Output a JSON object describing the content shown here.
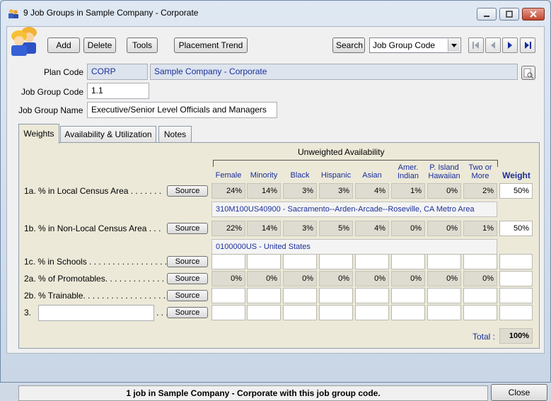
{
  "window": {
    "title": "9 Job Groups in Sample Company - Corporate"
  },
  "toolbar": {
    "add": "Add",
    "delete": "Delete",
    "tools": "Tools",
    "placement_trend": "Placement Trend",
    "search": "Search",
    "search_field": "Job Group Code"
  },
  "form": {
    "plan_code_label": "Plan Code",
    "plan_code": "CORP",
    "plan_name": "Sample Company - Corporate",
    "job_group_code_label": "Job Group Code",
    "job_group_code": "1.1",
    "job_group_name_label": "Job Group Name",
    "job_group_name": "Executive/Senior Level Officials and Managers"
  },
  "tabs": [
    "Weights",
    "Availability & Utilization",
    "Notes"
  ],
  "weights": {
    "group_header": "Unweighted Availability",
    "columns": [
      [
        "Female"
      ],
      [
        "Minority"
      ],
      [
        "Black"
      ],
      [
        "Hispanic"
      ],
      [
        "Asian"
      ],
      [
        "Amer.",
        "Indian"
      ],
      [
        "P. Island",
        "Hawaiian"
      ],
      [
        "Two or",
        "More"
      ]
    ],
    "weight_header": "Weight",
    "source_label": "Source",
    "rows": [
      {
        "label": "1a.  % in Local Census Area  . . . . . . .",
        "values": [
          "24%",
          "14%",
          "3%",
          "3%",
          "4%",
          "1%",
          "0%",
          "2%"
        ],
        "weight": "50%",
        "info": "310M100US40900 - Sacramento--Arden-Arcade--Roseville, CA Metro Area"
      },
      {
        "label": "1b.  % in Non-Local Census Area  . . .",
        "values": [
          "22%",
          "14%",
          "3%",
          "5%",
          "4%",
          "0%",
          "0%",
          "1%"
        ],
        "weight": "50%",
        "info": "0100000US - United States"
      },
      {
        "label": "1c.  % in Schools . . . . . . . . . . . . . . . . .",
        "values": [
          "",
          "",
          "",
          "",
          "",
          "",
          "",
          ""
        ],
        "weight": ""
      },
      {
        "label": "2a.  % of Promotables. . . . . . . . . . . . . .",
        "values": [
          "0%",
          "0%",
          "0%",
          "0%",
          "0%",
          "0%",
          "0%",
          "0%"
        ],
        "weight": ""
      },
      {
        "label": "2b.  % Trainable. . . . . . . . . . . . . . . . . . . .",
        "values": [
          "",
          "",
          "",
          "",
          "",
          "",
          "",
          ""
        ],
        "weight": ""
      },
      {
        "label": "3.",
        "values": [
          "",
          "",
          "",
          "",
          "",
          "",
          "",
          ""
        ],
        "weight": "",
        "suffix": ". . ."
      }
    ],
    "total_label": "Total :",
    "total": "100%"
  },
  "status": "1 job in Sample Company - Corporate with this job group code.",
  "close": "Close"
}
